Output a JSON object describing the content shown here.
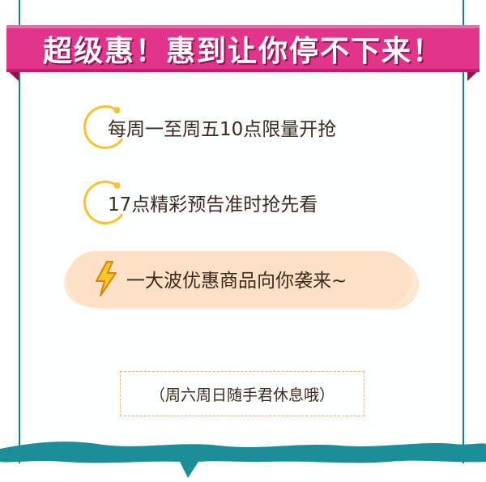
{
  "banner": {
    "title": "超级惠！惠到让你停不下来！",
    "color": "#e0358a"
  },
  "items": [
    {
      "text": "每周一至周五10点限量开抢",
      "icon": "ring-icon"
    },
    {
      "text": "17点精彩预告准时抢先看",
      "icon": "ring-icon"
    },
    {
      "text": "一大波优惠商品向你袭来~",
      "icon": "lightning-icon"
    }
  ],
  "note": "（周六周日随手君休息哦）",
  "colors": {
    "accent": "#f5c32d",
    "frame": "#1f7f89",
    "wave": "#1b8e98",
    "highlight": "#fde1c6"
  }
}
